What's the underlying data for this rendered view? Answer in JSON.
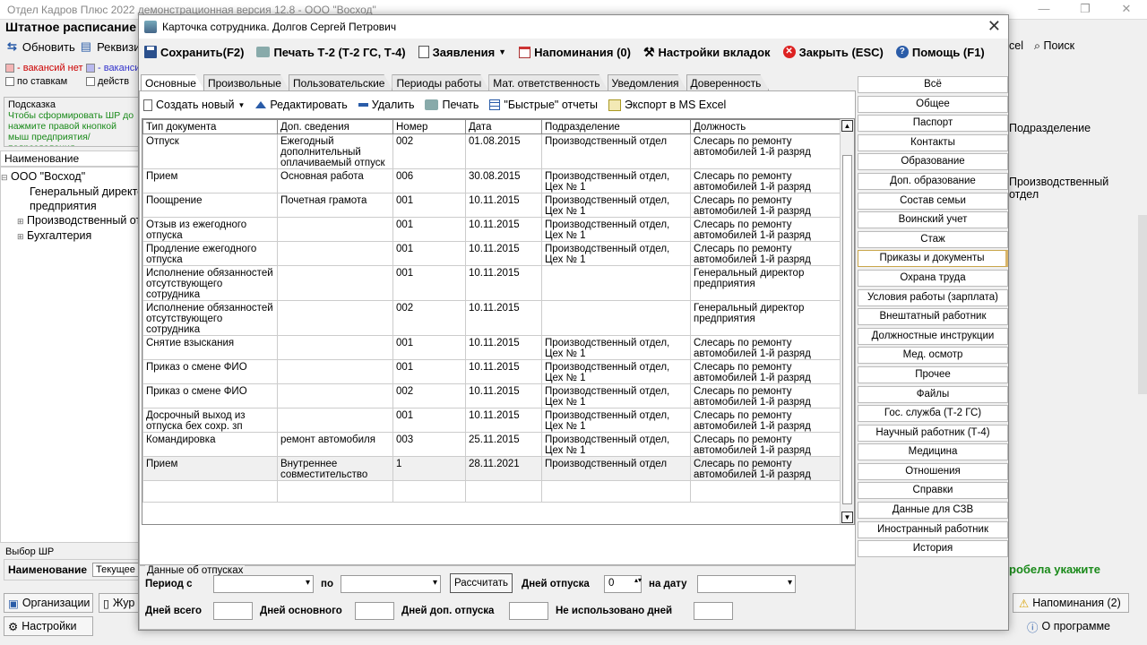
{
  "bg": {
    "title": "Отдел Кадров Плюс 2022 демонстрационная версия 12.8 - ООО \"Восход\"",
    "window_buttons": [
      "—",
      "❐",
      "✕"
    ],
    "heading": "Штатное расписание (Т",
    "toolbar": {
      "refresh": "Обновить",
      "requisites": "Реквизи"
    },
    "legend_no_vacancy": "- вакансий нет",
    "legend_vacancy": "- ваканси",
    "chk_by_rates": "по ставкам",
    "chk_active": "действ",
    "hint_title": "Подсказка",
    "hint_text": "Чтобы сформировать ШР до нажмите правой кнопкой мыш предприятия/подразделения",
    "tree_column": "Наименование",
    "tree": [
      "ООО \"Восход\"",
      "Генеральный директо",
      "предприятия",
      "Производственный от",
      "Бухгалтерия"
    ],
    "select_title": "Выбор ШР",
    "select_label": "Наименование",
    "select_value": "Текущее",
    "btn_orgs": "Организации",
    "btn_jur": "Жур",
    "btn_settings": "Настройки",
    "right_excel": "cel",
    "right_search": "Поиск",
    "right_col": "Подразделение",
    "right_cell": "Производственный отдел",
    "green_text": "робела укажите",
    "btn_reminders": "Напоминания (2)",
    "btn_about": "О программе"
  },
  "dialog": {
    "title": "Карточка сотрудника. Долгов Сергей Петрович",
    "close": "✕",
    "toolbar": {
      "save": "Сохранить(F2)",
      "print": "Печать Т-2 (Т-2 ГС, Т-4)",
      "statements": "Заявления",
      "reminders": "Напоминания (0)",
      "tab_settings": "Настройки вкладок",
      "close": "Закрыть (ESC)",
      "help": "Помощь (F1)"
    },
    "tabs": [
      "Основные",
      "Произвольные",
      "Пользовательские",
      "Периоды работы",
      "Мат. ответственность",
      "Уведомления",
      "Доверенность"
    ],
    "subtoolbar": {
      "create": "Создать новый",
      "edit": "Редактировать",
      "delete": "Удалить",
      "print": "Печать",
      "quick_reports": "\"Быстрые\" отчеты",
      "export": "Экспорт в MS Excel"
    },
    "columns": [
      "Тип документа",
      "Доп. сведения",
      "Номер",
      "Дата",
      "Подразделение",
      "Должность"
    ],
    "rows": [
      [
        "Отпуск",
        "Ежегодный дополнительный оплачиваемый отпуск",
        "002",
        "01.08.2015",
        "Производственный отдел",
        "Слесарь по ремонту автомобилей 1-й разряд"
      ],
      [
        "Прием",
        "Основная работа",
        "006",
        "30.08.2015",
        "Производственный отдел, Цех № 1",
        "Слесарь по ремонту автомобилей 1-й разряд"
      ],
      [
        "Поощрение",
        "Почетная грамота",
        "001",
        "10.11.2015",
        "Производственный отдел, Цех № 1",
        "Слесарь по ремонту автомобилей 1-й разряд"
      ],
      [
        "Отзыв из ежегодного отпуска",
        "",
        "001",
        "10.11.2015",
        "Производственный отдел, Цех № 1",
        "Слесарь по ремонту автомобилей 1-й разряд"
      ],
      [
        "Продление ежегодного отпуска",
        "",
        "001",
        "10.11.2015",
        "Производственный отдел, Цех № 1",
        "Слесарь по ремонту автомобилей 1-й разряд"
      ],
      [
        "Исполнение обязанностей отсутствующего сотрудника",
        "",
        "001",
        "10.11.2015",
        "",
        "Генеральный директор предприятия"
      ],
      [
        "Исполнение обязанностей отсутствующего сотрудника",
        "",
        "002",
        "10.11.2015",
        "",
        "Генеральный директор предприятия"
      ],
      [
        "Снятие взыскания",
        "",
        "001",
        "10.11.2015",
        "Производственный отдел, Цех № 1",
        "Слесарь по ремонту автомобилей 1-й разряд"
      ],
      [
        "Приказ о смене ФИО",
        "",
        "001",
        "10.11.2015",
        "Производственный отдел, Цех № 1",
        "Слесарь по ремонту автомобилей 1-й разряд"
      ],
      [
        "Приказ о смене ФИО",
        "",
        "002",
        "10.11.2015",
        "Производственный отдел, Цех № 1",
        "Слесарь по ремонту автомобилей 1-й разряд"
      ],
      [
        "Досрочный выход из отпуска бех сохр. зп",
        "",
        "001",
        "10.11.2015",
        "Производственный отдел, Цех № 1",
        "Слесарь по ремонту автомобилей 1-й разряд"
      ],
      [
        "Командировка",
        "ремонт автомобиля",
        "003",
        "25.11.2015",
        "Производственный отдел, Цех № 1",
        "Слесарь по ремонту автомобилей 1-й разряд"
      ],
      [
        "Прием",
        "Внутреннее совместительство",
        "1",
        "28.11.2021",
        "Производственный отдел",
        "Слесарь по ремонту автомобилей 1-й разряд"
      ]
    ],
    "right_buttons": [
      "Всё",
      "Общее",
      "Паспорт",
      "Контакты",
      "Образование",
      "Доп. образование",
      "Состав семьи",
      "Воинский учет",
      "Стаж",
      "Приказы и документы",
      "Охрана труда",
      "Условия работы (зарплата)",
      "Внештатный работник",
      "Должностные инструкции",
      "Мед. осмотр",
      "Прочее",
      "Файлы",
      "Гос. служба (Т-2 ГС)",
      "Научный работник (Т-4)",
      "Медицина",
      "Отношения",
      "Справки",
      "Данные для СЗВ",
      "Иностранный работник",
      "История"
    ],
    "active_right_button": "Приказы и документы",
    "vacation": {
      "legend": "Данные об отпусках",
      "period_from": "Период с",
      "to": "по",
      "calc": "Рассчитать",
      "vac_days": "Дней отпуска",
      "vac_days_value": "0",
      "on_date": "на дату",
      "total_days": "Дней всего",
      "main_days": "Дней основного",
      "extra_days": "Дней доп. отпуска",
      "unused_days": "Не использовано дней"
    }
  }
}
